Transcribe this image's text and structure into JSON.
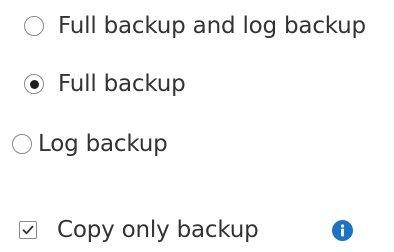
{
  "backup_type": {
    "selected": "full_backup",
    "options": [
      {
        "id": "full_and_log",
        "label": "Full backup and log backup"
      },
      {
        "id": "full_backup",
        "label": "Full backup"
      },
      {
        "id": "log_backup",
        "label": "Log backup"
      }
    ]
  },
  "copy_only": {
    "label": "Copy only backup",
    "checked": true,
    "info_icon": "info-icon"
  },
  "colors": {
    "text": "#333333",
    "control_border": "#8a8a8a",
    "radio_selected": "#1e1e1e",
    "info_icon": "#1a73c7"
  }
}
